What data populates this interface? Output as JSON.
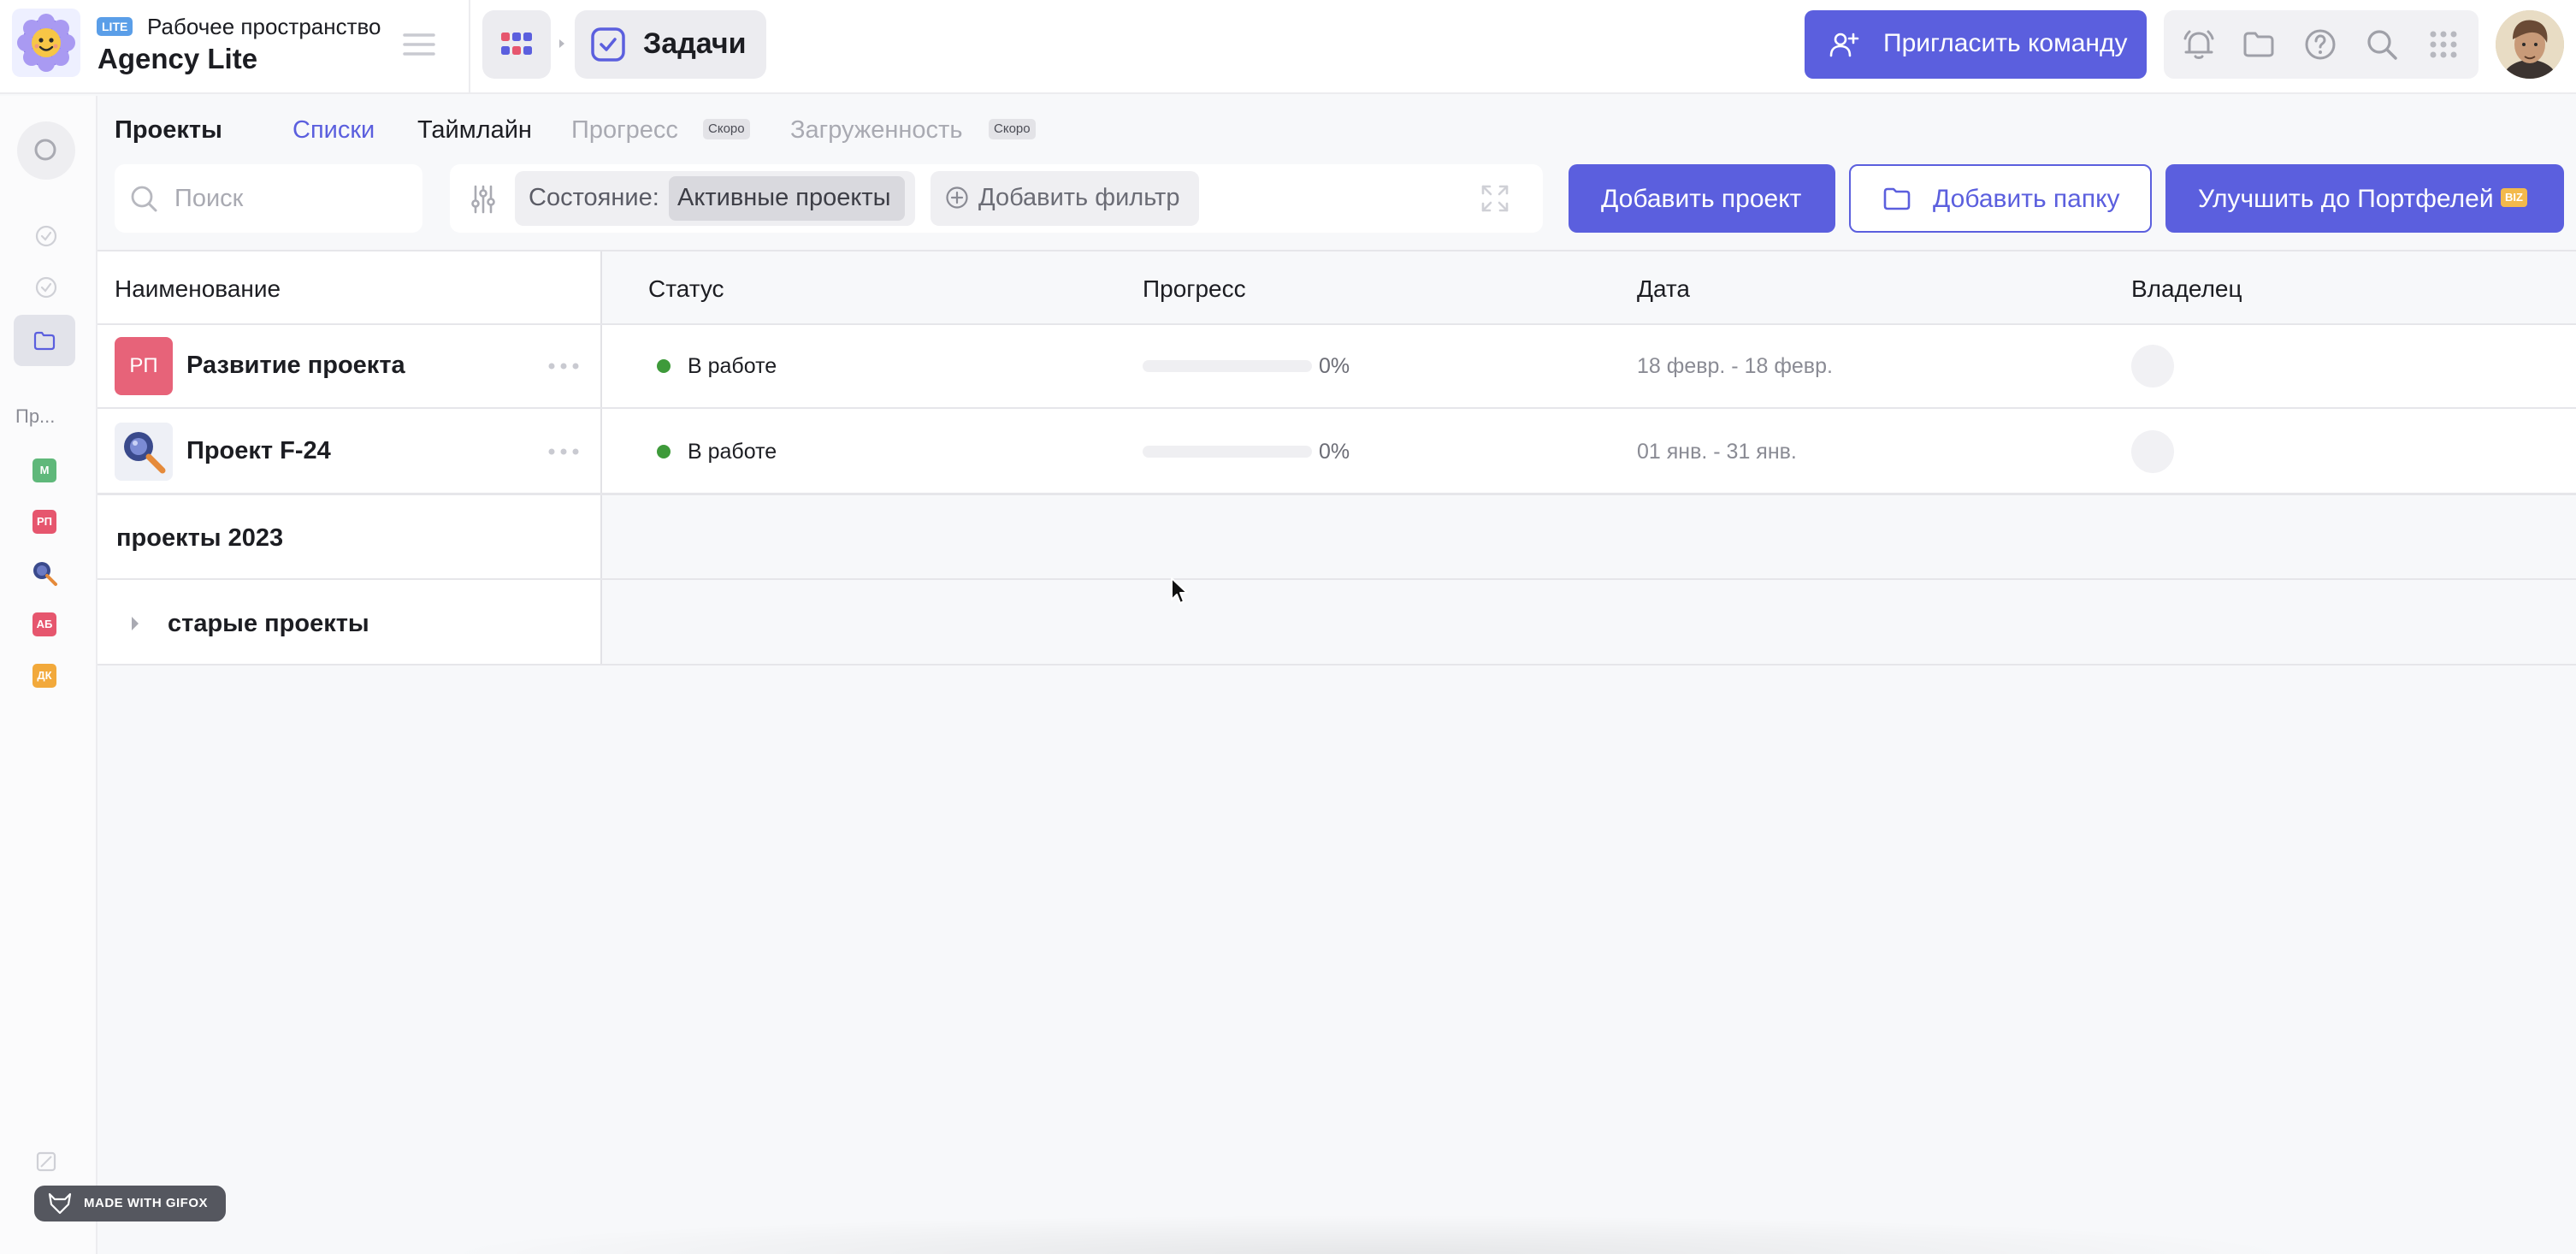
{
  "header": {
    "edition_badge": "LITE",
    "workspace_label": "Рабочее пространство",
    "workspace_name": "Agency Lite",
    "breadcrumb_title": "Задачи",
    "invite_button": "Пригласить команду",
    "icons": [
      "bell-icon",
      "folder-icon",
      "help-icon",
      "search-icon",
      "apps-grid-icon"
    ]
  },
  "sidebar": {
    "section_label": "Пр...",
    "projects": [
      {
        "initials": "М",
        "color": "#5fb87a"
      },
      {
        "initials": "РП",
        "color": "#e6566e"
      },
      {
        "initials": "",
        "color": "#3a4a8c"
      },
      {
        "initials": "АБ",
        "color": "#e6566e"
      },
      {
        "initials": "ДК",
        "color": "#f2a93b"
      }
    ]
  },
  "view_tabs": {
    "title": "Проекты",
    "tabs": [
      {
        "label": "Списки",
        "active": true
      },
      {
        "label": "Таймлайн",
        "active": false
      },
      {
        "label": "Прогресс",
        "active": false,
        "badge": "Скоро"
      },
      {
        "label": "Загруженность",
        "active": false,
        "badge": "Скоро"
      }
    ]
  },
  "toolbar": {
    "search_placeholder": "Поиск",
    "state_label": "Состояние:",
    "state_value": "Активные проекты",
    "add_filter": "Добавить фильтр",
    "add_project": "Добавить проект",
    "add_folder": "Добавить папку",
    "upgrade": "Улучшить до Портфелей",
    "upgrade_badge": "BIZ"
  },
  "table": {
    "columns": [
      "Наименование",
      "Статус",
      "Прогресс",
      "Дата",
      "Владелец"
    ],
    "rows": [
      {
        "icon": "РП",
        "icon_color": "#e6566e",
        "name": "Развитие проекта",
        "status": "В работе",
        "status_color": "#3e9a3a",
        "progress": "0%",
        "progress_value": 0,
        "date": "18 февр. - 18 февр."
      },
      {
        "icon": "",
        "icon_color": "#3a4a8c",
        "name": "Проект F-24",
        "status": "В работе",
        "status_color": "#3e9a3a",
        "progress": "0%",
        "progress_value": 0,
        "date": "01 янв. - 31 янв."
      }
    ],
    "groups": [
      "проекты 2023",
      "старые проекты"
    ]
  },
  "watermark": "MADE WITH GIFOX",
  "colors": {
    "accent": "#5b5fde",
    "status_active": "#3e9a3a",
    "rp_red": "#e6566e",
    "lite_blue": "#5a9ee8",
    "biz_orange": "#f3b94b"
  }
}
